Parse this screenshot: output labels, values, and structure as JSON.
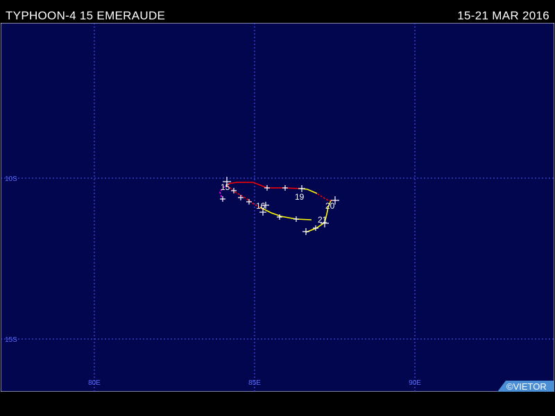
{
  "header": {
    "title": "TYPHOON-4 15 EMERAUDE",
    "date_range": "15-21 MAR 2016"
  },
  "map": {
    "lat_labels": [
      "10S",
      "15S"
    ],
    "lon_labels": [
      "80E",
      "85E",
      "90E"
    ],
    "colors": {
      "background": "#02064f",
      "border": "#ffffff",
      "gridline": "#4f5cff",
      "axis_label": "#5b6cff",
      "track_tropical_depression": "#ff00ff",
      "track_tropical_storm": "#ff0000",
      "track_category_1": "#ffff00",
      "position_mark": "#ffffff"
    },
    "day_labels": [
      "15",
      "16",
      "19",
      "20",
      "21"
    ],
    "credit": "©VIETOR"
  }
}
